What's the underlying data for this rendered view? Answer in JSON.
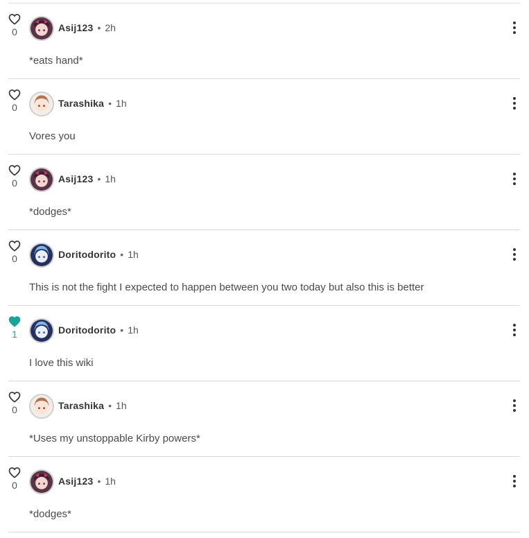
{
  "comments": [
    {
      "likes": "0",
      "liked": false,
      "username": "Asij123",
      "separator": "•",
      "time": "2h",
      "text": "*eats hand*",
      "avatar": "asij-avatar"
    },
    {
      "likes": "0",
      "liked": false,
      "username": "Tarashika",
      "separator": "•",
      "time": "1h",
      "text": "Vores you",
      "avatar": "tarashika-avatar"
    },
    {
      "likes": "0",
      "liked": false,
      "username": "Asij123",
      "separator": "•",
      "time": "1h",
      "text": "*dodges*",
      "avatar": "asij-avatar"
    },
    {
      "likes": "0",
      "liked": false,
      "username": "Doritodorito",
      "separator": "•",
      "time": "1h",
      "text": "This is not the fight I expected to happen between you two today but also this is better",
      "avatar": "doritodorito-avatar"
    },
    {
      "likes": "1",
      "liked": true,
      "username": "Doritodorito",
      "separator": "•",
      "time": "1h",
      "text": "I love this wiki",
      "avatar": "doritodorito-avatar"
    },
    {
      "likes": "0",
      "liked": false,
      "username": "Tarashika",
      "separator": "•",
      "time": "1h",
      "text": "*Uses my unstoppable Kirby powers*",
      "avatar": "tarashika-avatar"
    },
    {
      "likes": "0",
      "liked": false,
      "username": "Asij123",
      "separator": "•",
      "time": "1h",
      "text": "*dodges*",
      "avatar": "asij-avatar"
    }
  ],
  "colors": {
    "liked": "#1aa39a",
    "divider": "#d9d9d9",
    "text": "#4a4a4a"
  }
}
